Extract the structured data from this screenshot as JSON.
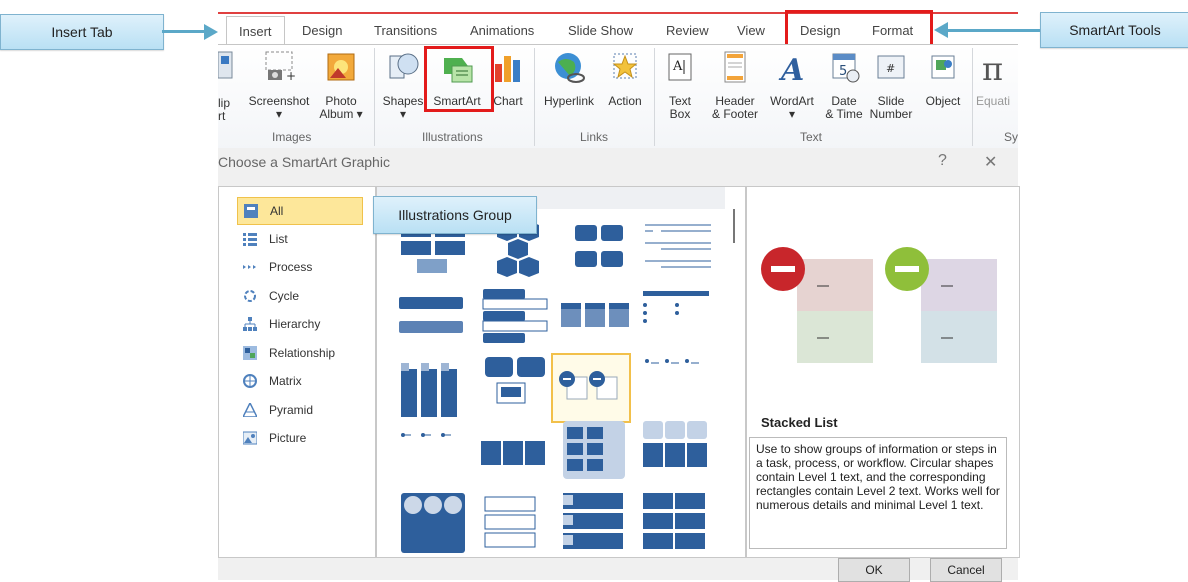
{
  "callouts": {
    "insert_tab": "Insert Tab",
    "smartart_tools": "SmartArt Tools",
    "illustrations_group": "Illustrations Group"
  },
  "ribbon": {
    "tabs": [
      "Insert",
      "Design",
      "Transitions",
      "Animations",
      "Slide Show",
      "Review",
      "View",
      "Design",
      "Format"
    ],
    "active_tab": "Insert",
    "groups": {
      "images": "Images",
      "illustrations": "Illustrations",
      "links": "Links",
      "text": "Text",
      "symbols_partial": "Sy"
    },
    "buttons": {
      "clip_art_partial": [
        "lip",
        "rt"
      ],
      "screenshot": "Screenshot",
      "photo_album": [
        "Photo",
        "Album ▾"
      ],
      "shapes": "Shapes",
      "smartart": "SmartArt",
      "chart": "Chart",
      "hyperlink": "Hyperlink",
      "action": "Action",
      "text_box": [
        "Text",
        "Box"
      ],
      "header_footer": [
        "Header",
        "& Footer"
      ],
      "wordart": "WordArt",
      "date_time": [
        "Date",
        "& Time"
      ],
      "slide_number": [
        "Slide",
        "Number"
      ],
      "object": "Object",
      "equation_partial": "Equati"
    }
  },
  "dialog": {
    "title": "Choose a SmartArt Graphic",
    "help": "?",
    "close": "✕",
    "categories": [
      "All",
      "List",
      "Process",
      "Cycle",
      "Hierarchy",
      "Relationship",
      "Matrix",
      "Pyramid",
      "Picture"
    ],
    "selected_category": "All",
    "preview": {
      "title": "Stacked List",
      "description": "Use to show groups of information or steps in a task, process, or workflow. Circular shapes contain Level 1 text, and the corresponding rectangles contain Level 2 text. Works well for numerous details and minimal Level 1 text."
    },
    "ok_label": "OK",
    "cancel_label": "Cancel"
  },
  "colors": {
    "highlight_red": "#e31b1b",
    "accent_blue": "#2e5f9c",
    "selection_yellow": "#fde79a"
  }
}
